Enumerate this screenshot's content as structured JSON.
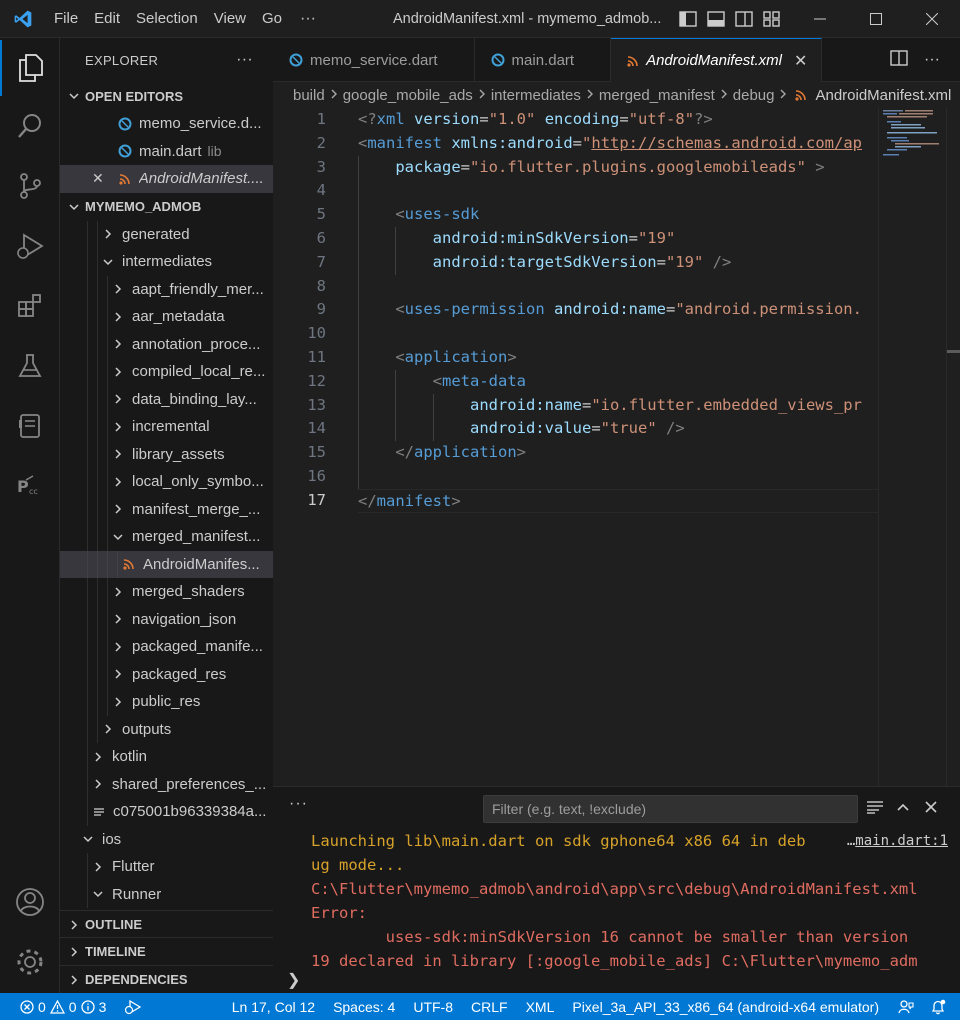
{
  "titlebar": {
    "menu": [
      "File",
      "Edit",
      "Selection",
      "View",
      "Go"
    ],
    "more": "···",
    "title": "AndroidManifest.xml - mymemo_admob..."
  },
  "explorer": {
    "header": "EXPLORER",
    "header_more": "···",
    "open_editors_label": "OPEN EDITORS",
    "open_editors": [
      {
        "name": "memo_service.d...",
        "dir": "",
        "icon": "dart-icon"
      },
      {
        "name": "main.dart",
        "dir": "lib",
        "icon": "dart-icon"
      },
      {
        "name": "AndroidManifest....",
        "dir": "",
        "icon": "rss-xml-icon"
      }
    ],
    "project_label": "MYMEMO_ADMOB",
    "tree": [
      {
        "label": "generated",
        "open": false,
        "level": 4
      },
      {
        "label": "intermediates",
        "open": true,
        "level": 4
      },
      {
        "label": "aapt_friendly_mer...",
        "open": false,
        "level": 5
      },
      {
        "label": "aar_metadata",
        "open": false,
        "level": 5
      },
      {
        "label": "annotation_proce...",
        "open": false,
        "level": 5
      },
      {
        "label": "compiled_local_re...",
        "open": false,
        "level": 5
      },
      {
        "label": "data_binding_lay...",
        "open": false,
        "level": 5
      },
      {
        "label": "incremental",
        "open": false,
        "level": 5
      },
      {
        "label": "library_assets",
        "open": false,
        "level": 5
      },
      {
        "label": "local_only_symbo...",
        "open": false,
        "level": 5
      },
      {
        "label": "manifest_merge_...",
        "open": false,
        "level": 5
      },
      {
        "label": "merged_manifest...",
        "open": true,
        "level": 5
      },
      {
        "label": "AndroidManifes...",
        "file": true,
        "level": 6
      },
      {
        "label": "merged_shaders",
        "open": false,
        "level": 5
      },
      {
        "label": "navigation_json",
        "open": false,
        "level": 5
      },
      {
        "label": "packaged_manife...",
        "open": false,
        "level": 5
      },
      {
        "label": "packaged_res",
        "open": false,
        "level": 5
      },
      {
        "label": "public_res",
        "open": false,
        "level": 5
      },
      {
        "label": "outputs",
        "open": false,
        "level": 4
      },
      {
        "label": "kotlin",
        "open": false,
        "level": 3
      },
      {
        "label": "shared_preferences_...",
        "open": false,
        "level": 3
      },
      {
        "label": "c075001b96339384a...",
        "file": true,
        "level": 3,
        "plain": true
      },
      {
        "label": "ios",
        "open": true,
        "level": 2
      },
      {
        "label": "Flutter",
        "open": false,
        "level": 3
      },
      {
        "label": "Runner",
        "open": true,
        "level": 3
      }
    ],
    "outline": "OUTLINE",
    "timeline": "TIMELINE",
    "dependencies": "DEPENDENCIES"
  },
  "tabs": [
    {
      "label": "memo_service.dart",
      "icon": "dart-icon",
      "active": false
    },
    {
      "label": "main.dart",
      "icon": "dart-icon",
      "active": false
    },
    {
      "label": "AndroidManifest.xml",
      "icon": "rss-xml-icon",
      "active": true
    }
  ],
  "tab_close": "✕",
  "breadcrumb": [
    "build",
    "google_mobile_ads",
    "intermediates",
    "merged_manifest",
    "debug",
    "AndroidManifest.xml"
  ],
  "editor": {
    "current_line": 17,
    "lines": [
      {
        "n": "1",
        "indent": 0,
        "tokens": [
          [
            "br",
            "<?"
          ],
          [
            "tag",
            "xml"
          ],
          [
            "txt",
            " "
          ],
          [
            "attr",
            "version"
          ],
          [
            "txt",
            "="
          ],
          [
            "str",
            "\"1.0\""
          ],
          [
            "txt",
            " "
          ],
          [
            "attr",
            "encoding"
          ],
          [
            "txt",
            "="
          ],
          [
            "str",
            "\"utf-8\""
          ],
          [
            "br",
            "?>"
          ]
        ]
      },
      {
        "n": "2",
        "indent": 0,
        "tokens": [
          [
            "br",
            "<"
          ],
          [
            "tag",
            "manifest"
          ],
          [
            "txt",
            " "
          ],
          [
            "attr",
            "xmlns:android"
          ],
          [
            "txt",
            "="
          ],
          [
            "str",
            "\""
          ],
          [
            "link",
            "http://schemas.android.com/ap"
          ]
        ]
      },
      {
        "n": "3",
        "indent": 1,
        "tokens": [
          [
            "attr",
            "package"
          ],
          [
            "txt",
            "="
          ],
          [
            "str",
            "\"io.flutter.plugins.googlemobileads\""
          ],
          [
            "txt",
            " "
          ],
          [
            "br",
            ">"
          ]
        ]
      },
      {
        "n": "4",
        "indent": 1,
        "tokens": []
      },
      {
        "n": "5",
        "indent": 1,
        "tokens": [
          [
            "br",
            "<"
          ],
          [
            "tag",
            "uses-sdk"
          ]
        ]
      },
      {
        "n": "6",
        "indent": 2,
        "tokens": [
          [
            "attr",
            "android:minSdkVersion"
          ],
          [
            "txt",
            "="
          ],
          [
            "str",
            "\"19\""
          ]
        ]
      },
      {
        "n": "7",
        "indent": 2,
        "tokens": [
          [
            "attr",
            "android:targetSdkVersion"
          ],
          [
            "txt",
            "="
          ],
          [
            "str",
            "\"19\""
          ],
          [
            "txt",
            " "
          ],
          [
            "br",
            "/>"
          ]
        ]
      },
      {
        "n": "8",
        "indent": 1,
        "tokens": []
      },
      {
        "n": "9",
        "indent": 1,
        "tokens": [
          [
            "br",
            "<"
          ],
          [
            "tag",
            "uses-permission"
          ],
          [
            "txt",
            " "
          ],
          [
            "attr",
            "android:name"
          ],
          [
            "txt",
            "="
          ],
          [
            "str",
            "\"android.permission."
          ]
        ]
      },
      {
        "n": "10",
        "indent": 1,
        "tokens": []
      },
      {
        "n": "11",
        "indent": 1,
        "tokens": [
          [
            "br",
            "<"
          ],
          [
            "tag",
            "application"
          ],
          [
            "br",
            ">"
          ]
        ]
      },
      {
        "n": "12",
        "indent": 2,
        "tokens": [
          [
            "br",
            "<"
          ],
          [
            "tag",
            "meta-data"
          ]
        ]
      },
      {
        "n": "13",
        "indent": 3,
        "tokens": [
          [
            "attr",
            "android:name"
          ],
          [
            "txt",
            "="
          ],
          [
            "str",
            "\"io.flutter.embedded_views_pr"
          ]
        ]
      },
      {
        "n": "14",
        "indent": 3,
        "tokens": [
          [
            "attr",
            "android:value"
          ],
          [
            "txt",
            "="
          ],
          [
            "str",
            "\"true\""
          ],
          [
            "txt",
            " "
          ],
          [
            "br",
            "/>"
          ]
        ]
      },
      {
        "n": "15",
        "indent": 1,
        "tokens": [
          [
            "br",
            "</"
          ],
          [
            "tag",
            "application"
          ],
          [
            "br",
            ">"
          ]
        ]
      },
      {
        "n": "16",
        "indent": 1,
        "tokens": []
      },
      {
        "n": "17",
        "indent": 0,
        "tokens": [
          [
            "br",
            "</"
          ],
          [
            "tag",
            "manifest"
          ],
          [
            "br",
            ">"
          ]
        ]
      }
    ]
  },
  "panel": {
    "more": "···",
    "filter_placeholder": "Filter (e.g. text, !exclude)",
    "source_link": "main.dart:1",
    "source_prefix": "…",
    "lines": [
      {
        "text": "Launching lib\\main.dart on sdk gphone64 x86 64 in deb",
        "kind": "warn"
      },
      {
        "text": "ug mode...",
        "kind": "warn"
      },
      {
        "text": "C:\\Flutter\\mymemo_admob\\android\\app\\src\\debug\\AndroidManifest.xml",
        "kind": "error"
      },
      {
        "text": "Error:",
        "kind": "error"
      },
      {
        "text": "        uses-sdk:minSdkVersion 16 cannot be smaller than version",
        "kind": "error"
      },
      {
        "text": "19 declared in library [:google_mobile_ads] C:\\Flutter\\mymemo_adm",
        "kind": "error"
      }
    ],
    "prompt": "❯"
  },
  "statusbar": {
    "errors": "0",
    "warnings": "0",
    "info": "3",
    "position": "Ln 17, Col 12",
    "spaces": "Spaces: 4",
    "encoding": "UTF-8",
    "eol": "CRLF",
    "language": "XML",
    "device": "Pixel_3a_API_33_x86_64 (android-x64 emulator)"
  },
  "colors": {
    "accent": "#0078d4",
    "tag": "#569cd6",
    "attr": "#9cdcfe",
    "string": "#ce9178",
    "error_text": "#e06c60",
    "warn_text": "#d7a22a",
    "dart": "#40a0d8",
    "xml_rss": "#e37933"
  }
}
